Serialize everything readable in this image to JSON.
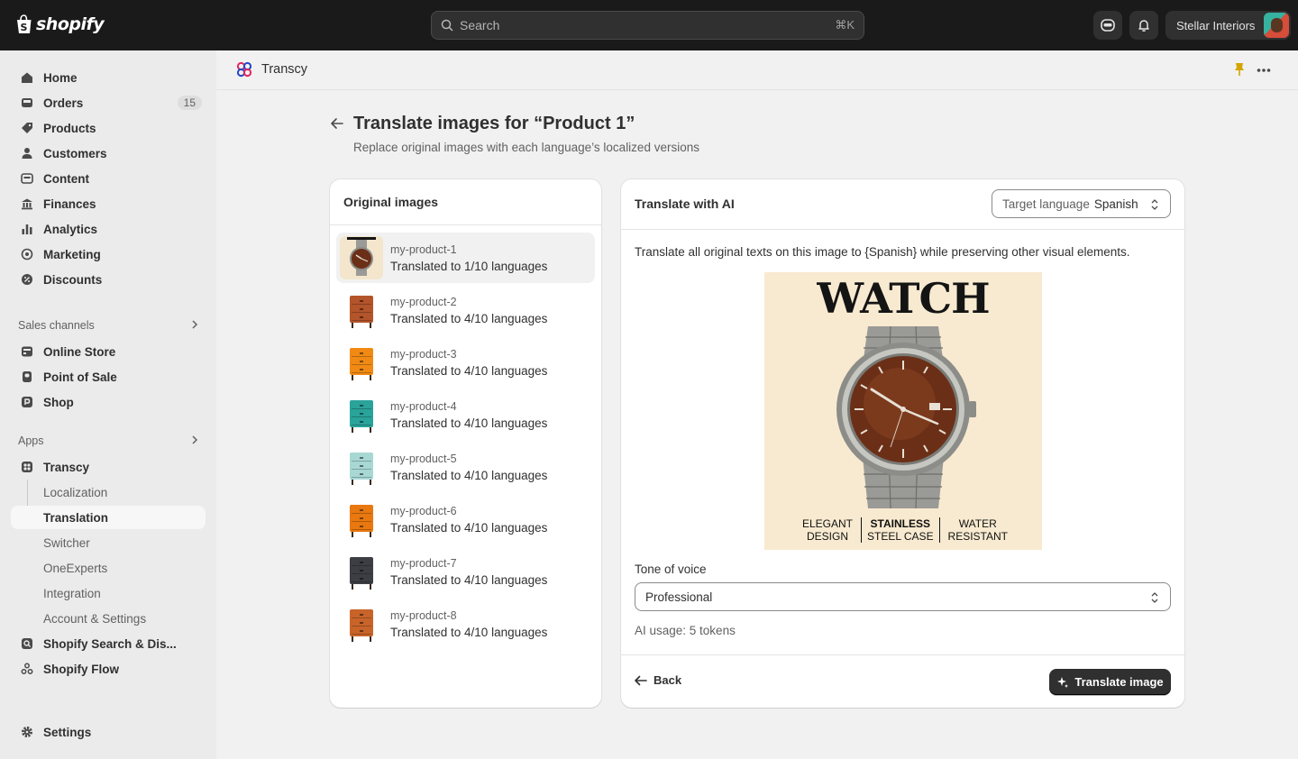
{
  "topbar": {
    "logo_text": "shopify",
    "search_placeholder": "Search",
    "search_shortcut": "⌘K",
    "store_name": "Stellar Interiors"
  },
  "sidebar": {
    "main": [
      {
        "label": "Home",
        "icon": "home-icon"
      },
      {
        "label": "Orders",
        "icon": "orders-icon",
        "badge": "15"
      },
      {
        "label": "Products",
        "icon": "tag-icon"
      },
      {
        "label": "Customers",
        "icon": "person-icon"
      },
      {
        "label": "Content",
        "icon": "content-icon"
      },
      {
        "label": "Finances",
        "icon": "bank-icon"
      },
      {
        "label": "Analytics",
        "icon": "bar-chart-icon"
      },
      {
        "label": "Marketing",
        "icon": "target-icon"
      },
      {
        "label": "Discounts",
        "icon": "discount-icon"
      }
    ],
    "sales_channels_label": "Sales channels",
    "sales_channels": [
      {
        "label": "Online Store",
        "icon": "store-icon"
      },
      {
        "label": "Point of Sale",
        "icon": "pos-icon"
      },
      {
        "label": "Shop",
        "icon": "shop-icon"
      }
    ],
    "apps_label": "Apps",
    "app_main": {
      "label": "Transcy",
      "icon": "transcy-icon"
    },
    "app_subs": [
      "Localization",
      "Translation",
      "Switcher",
      "OneExperts",
      "Integration",
      "Account & Settings"
    ],
    "other_apps": [
      {
        "label": "Shopify Search & Dis...",
        "icon": "search-app-icon"
      },
      {
        "label": "Shopify Flow",
        "icon": "flow-icon"
      }
    ],
    "settings_label": "Settings"
  },
  "app_header": {
    "name": "Transcy"
  },
  "page": {
    "title": "Translate images for “Product 1”",
    "subtitle": "Replace original images with each language’s localized versions"
  },
  "original_images": {
    "title": "Original images",
    "items": [
      {
        "name": "my-product-1",
        "status": "Translated to 1/10 languages",
        "color": "#a9754c"
      },
      {
        "name": "my-product-2",
        "status": "Translated to 4/10 languages",
        "color": "#b3542a"
      },
      {
        "name": "my-product-3",
        "status": "Translated to 4/10 languages",
        "color": "#f08a14"
      },
      {
        "name": "my-product-4",
        "status": "Translated to 4/10 languages",
        "color": "#2aa39a"
      },
      {
        "name": "my-product-5",
        "status": "Translated to 4/10 languages",
        "color": "#a8d8d4"
      },
      {
        "name": "my-product-6",
        "status": "Translated to 4/10 languages",
        "color": "#e8780f"
      },
      {
        "name": "my-product-7",
        "status": "Translated to 4/10 languages",
        "color": "#3d3d44"
      },
      {
        "name": "my-product-8",
        "status": "Translated to 4/10 languages",
        "color": "#c8642a"
      }
    ]
  },
  "translate": {
    "title": "Translate with AI",
    "target_label": "Target language",
    "target_value": "Spanish",
    "prompt": "Translate all original texts on this image to {Spanish} while preserving other visual elements.",
    "preview": {
      "headline": "WATCH",
      "features": [
        {
          "l1": "ELEGANT",
          "l2": "DESIGN"
        },
        {
          "l1": "STAINLESS",
          "l2": "STEEL CASE"
        },
        {
          "l1": "WATER",
          "l2": "RESISTANT"
        }
      ]
    },
    "tone_label": "Tone of voice",
    "tone_value": "Professional",
    "usage": "AI usage: 5 tokens",
    "back_label": "Back",
    "translate_label": "Translate image"
  }
}
